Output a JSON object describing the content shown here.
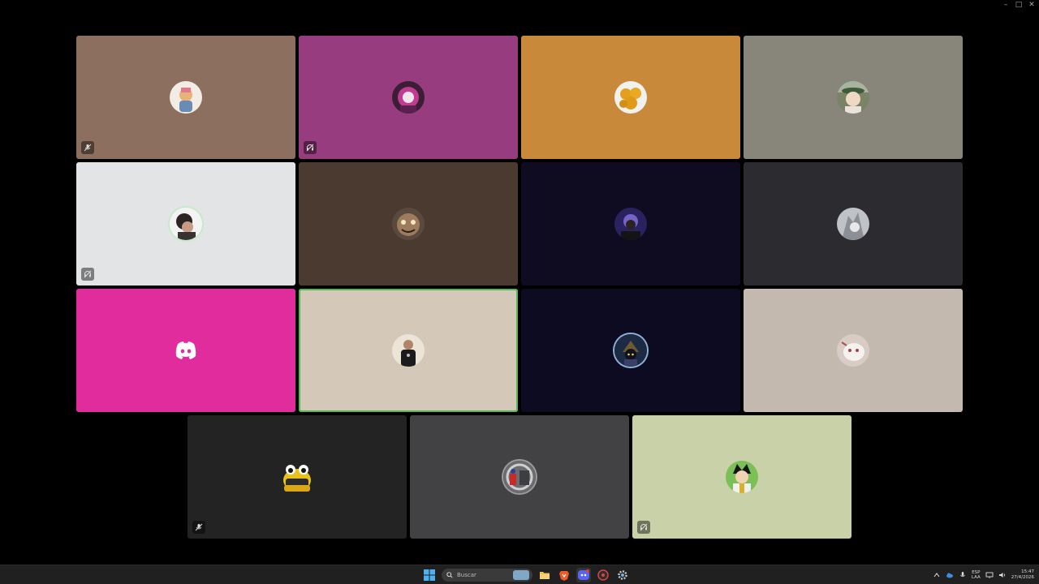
{
  "window": {
    "minimize_glyph": "–",
    "maximize_glyph": "□",
    "close_glyph": "✕"
  },
  "tiles": [
    {
      "id": "p1",
      "bg": "#8c6f5e",
      "status": "muted-mic"
    },
    {
      "id": "p2",
      "bg": "#973c7f",
      "status": "deafened"
    },
    {
      "id": "p3",
      "bg": "#c8893b",
      "status": null
    },
    {
      "id": "p4",
      "bg": "#88857a",
      "status": null
    },
    {
      "id": "p5",
      "bg": "#e3e4e5",
      "status": "deafened"
    },
    {
      "id": "p6",
      "bg": "#4a3a30",
      "status": null
    },
    {
      "id": "p7",
      "bg": "#0f0c22",
      "status": null
    },
    {
      "id": "p8",
      "bg": "#2c2c30",
      "status": null
    },
    {
      "id": "p9",
      "bg": "#e02c9c",
      "status": null,
      "default_avatar": true
    },
    {
      "id": "p10",
      "bg": "#d4c8b8",
      "status": null,
      "speaking": true
    },
    {
      "id": "p11",
      "bg": "#0d0b22",
      "status": null
    },
    {
      "id": "p12",
      "bg": "#c4b9ae",
      "status": null
    },
    {
      "id": "p13",
      "bg": "#232323",
      "status": "muted-mic"
    },
    {
      "id": "p14",
      "bg": "#424244",
      "status": null
    },
    {
      "id": "p15",
      "bg": "#c9d1a8",
      "status": "deafened"
    }
  ],
  "taskbar": {
    "search_placeholder": "Buscar",
    "apps": [
      "windows-start",
      "search",
      "file-explorer",
      "brave-browser",
      "discord",
      "browser-2",
      "settings"
    ],
    "tray": {
      "lang_top": "ESP",
      "lang_bottom": "LAA",
      "time": "15:47",
      "date": "27/4/2026"
    }
  }
}
